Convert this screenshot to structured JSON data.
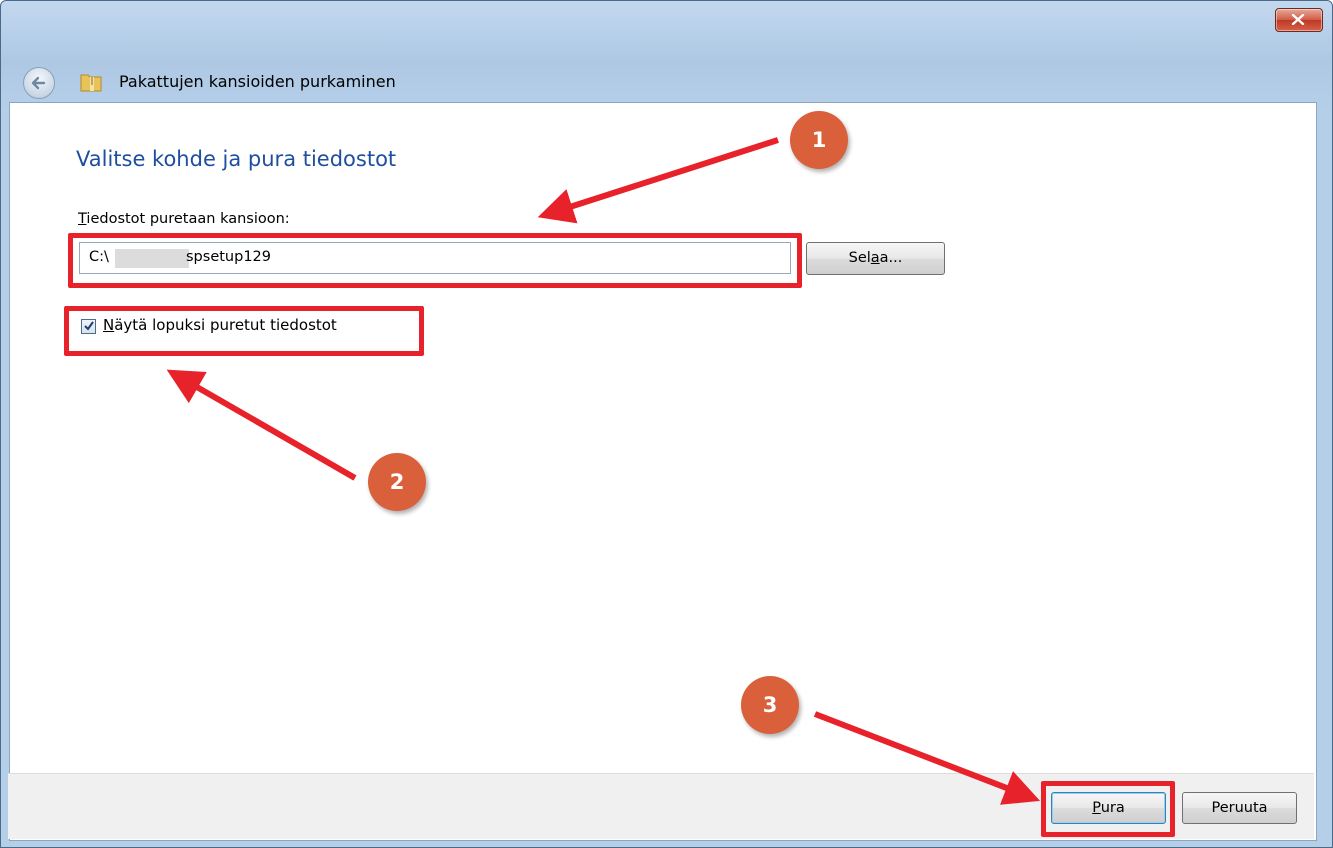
{
  "window": {
    "title": "Pakattujen kansioiden purkaminen",
    "back_icon": "back-arrow-icon",
    "app_icon": "zip-folder-icon",
    "close_icon": "close-icon"
  },
  "content": {
    "heading": "Valitse kohde ja pura tiedostot",
    "label_first": "T",
    "label_rest": "iedostot puretaan kansioon:",
    "path_prefix": "C:\\",
    "path_suffix": "spsetup129",
    "browse_pre": "Sel",
    "browse_u": "a",
    "browse_post": "a...",
    "checkbox_checked": true,
    "checkbox_first": "N",
    "checkbox_rest": "äytä lopuksi puretut tiedostot"
  },
  "footer": {
    "ok_first": "P",
    "ok_rest": "ura",
    "cancel_label": "Peruuta"
  },
  "annotations": {
    "badge1": "1",
    "badge2": "2",
    "badge3": "3",
    "highlight_color": "#e8222a",
    "badge_color": "#d9603a"
  }
}
